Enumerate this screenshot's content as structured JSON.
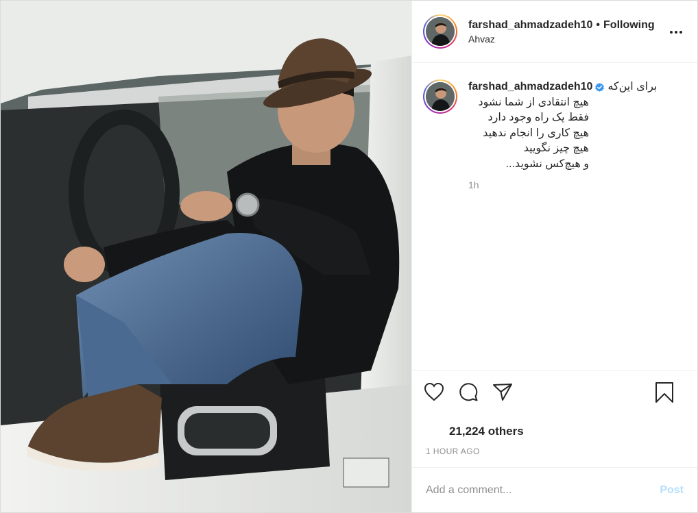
{
  "post": {
    "account": {
      "username": "farshad_ahmadzadeh10",
      "separator": "•",
      "follow_state": "Following",
      "location": "Ahvaz"
    },
    "caption": {
      "username": "farshad_ahmadzadeh10",
      "lines": [
        "برای این‌که",
        "هیچ انتقادی از شما نشود",
        "فقط یک راه وجود دارد",
        "هیچ کاری را انجام ندهید",
        "هیچ چیز نگویید",
        "و هیچ‌کس نشوید..."
      ],
      "time": "1h"
    },
    "likes_text": "21,224 others",
    "timestamp": "1 HOUR AGO",
    "comment": {
      "placeholder": "Add a comment...",
      "post_label": "Post"
    },
    "icons": {
      "more": "more-options-icon",
      "like": "heart-icon",
      "comment": "comment-icon",
      "share": "paper-plane-icon",
      "save": "bookmark-icon",
      "verified": "verified-badge-icon"
    },
    "colors": {
      "verified": "#3897f0",
      "post_button_disabled": "#b2dffc",
      "secondary_text": "#8e8e8e"
    }
  }
}
